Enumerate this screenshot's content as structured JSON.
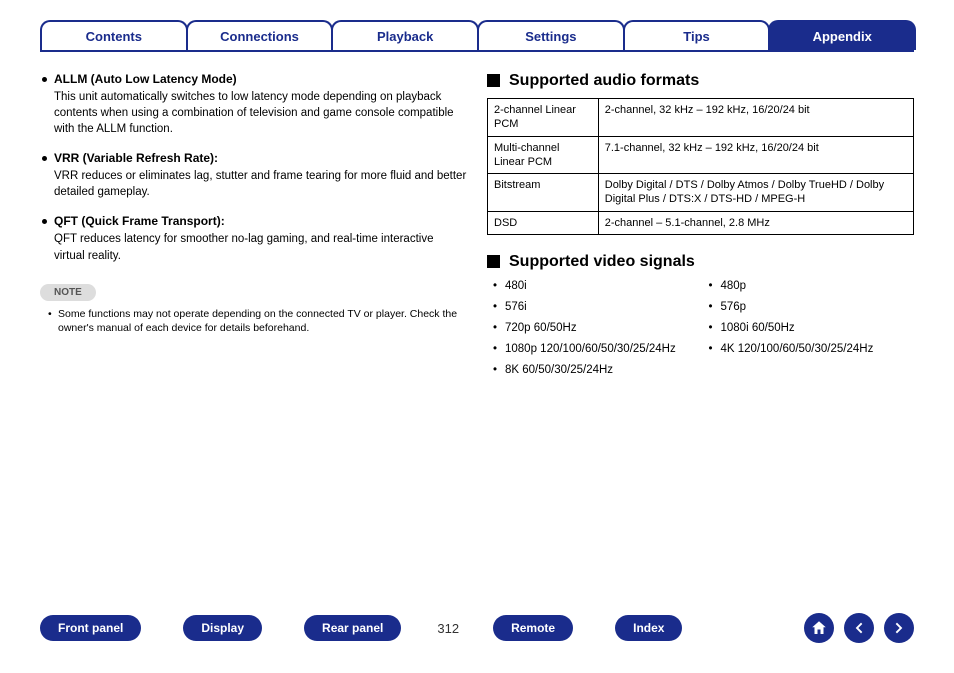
{
  "tabs": {
    "items": [
      {
        "label": "Contents",
        "active": false
      },
      {
        "label": "Connections",
        "active": false
      },
      {
        "label": "Playback",
        "active": false
      },
      {
        "label": "Settings",
        "active": false
      },
      {
        "label": "Tips",
        "active": false
      },
      {
        "label": "Appendix",
        "active": true
      }
    ]
  },
  "left": {
    "features": [
      {
        "title": "ALLM (Auto Low Latency Mode)",
        "desc": "This unit automatically switches to low latency mode depending on playback contents when using a combination of television and game console compatible with the ALLM function."
      },
      {
        "title": "VRR (Variable Refresh Rate):",
        "desc": "VRR reduces or eliminates lag, stutter and frame tearing for more fluid and better detailed gameplay."
      },
      {
        "title": "QFT (Quick Frame Transport):",
        "desc": "QFT reduces latency for smoother no-lag gaming, and real-time interactive virtual reality."
      }
    ],
    "note_label": "NOTE",
    "note_text": "Some functions may not operate depending on the connected TV or player. Check the owner's manual of each device for details beforehand."
  },
  "right": {
    "audio_heading": "Supported audio formats",
    "audio_rows": [
      {
        "k": "2-channel Linear PCM",
        "v": "2-channel, 32 kHz – 192 kHz, 16/20/24 bit"
      },
      {
        "k": "Multi-channel Linear PCM",
        "v": "7.1-channel, 32 kHz – 192 kHz, 16/20/24 bit"
      },
      {
        "k": "Bitstream",
        "v": "Dolby Digital / DTS / Dolby Atmos / Dolby TrueHD / Dolby Digital Plus / DTS:X / DTS-HD / MPEG-H"
      },
      {
        "k": "DSD",
        "v": "2-channel – 5.1-channel, 2.8 MHz"
      }
    ],
    "video_heading": "Supported video signals",
    "video_signals_col1": [
      "480i",
      "576i",
      "720p 60/50Hz",
      "1080p 120/100/60/50/30/25/24Hz",
      "8K 60/50/30/25/24Hz"
    ],
    "video_signals_col2": [
      "480p",
      "576p",
      "1080i 60/50Hz",
      "4K 120/100/60/50/30/25/24Hz"
    ]
  },
  "footer": {
    "pills": [
      "Front panel",
      "Display",
      "Rear panel"
    ],
    "page": "312",
    "pills_right": [
      "Remote",
      "Index"
    ]
  }
}
